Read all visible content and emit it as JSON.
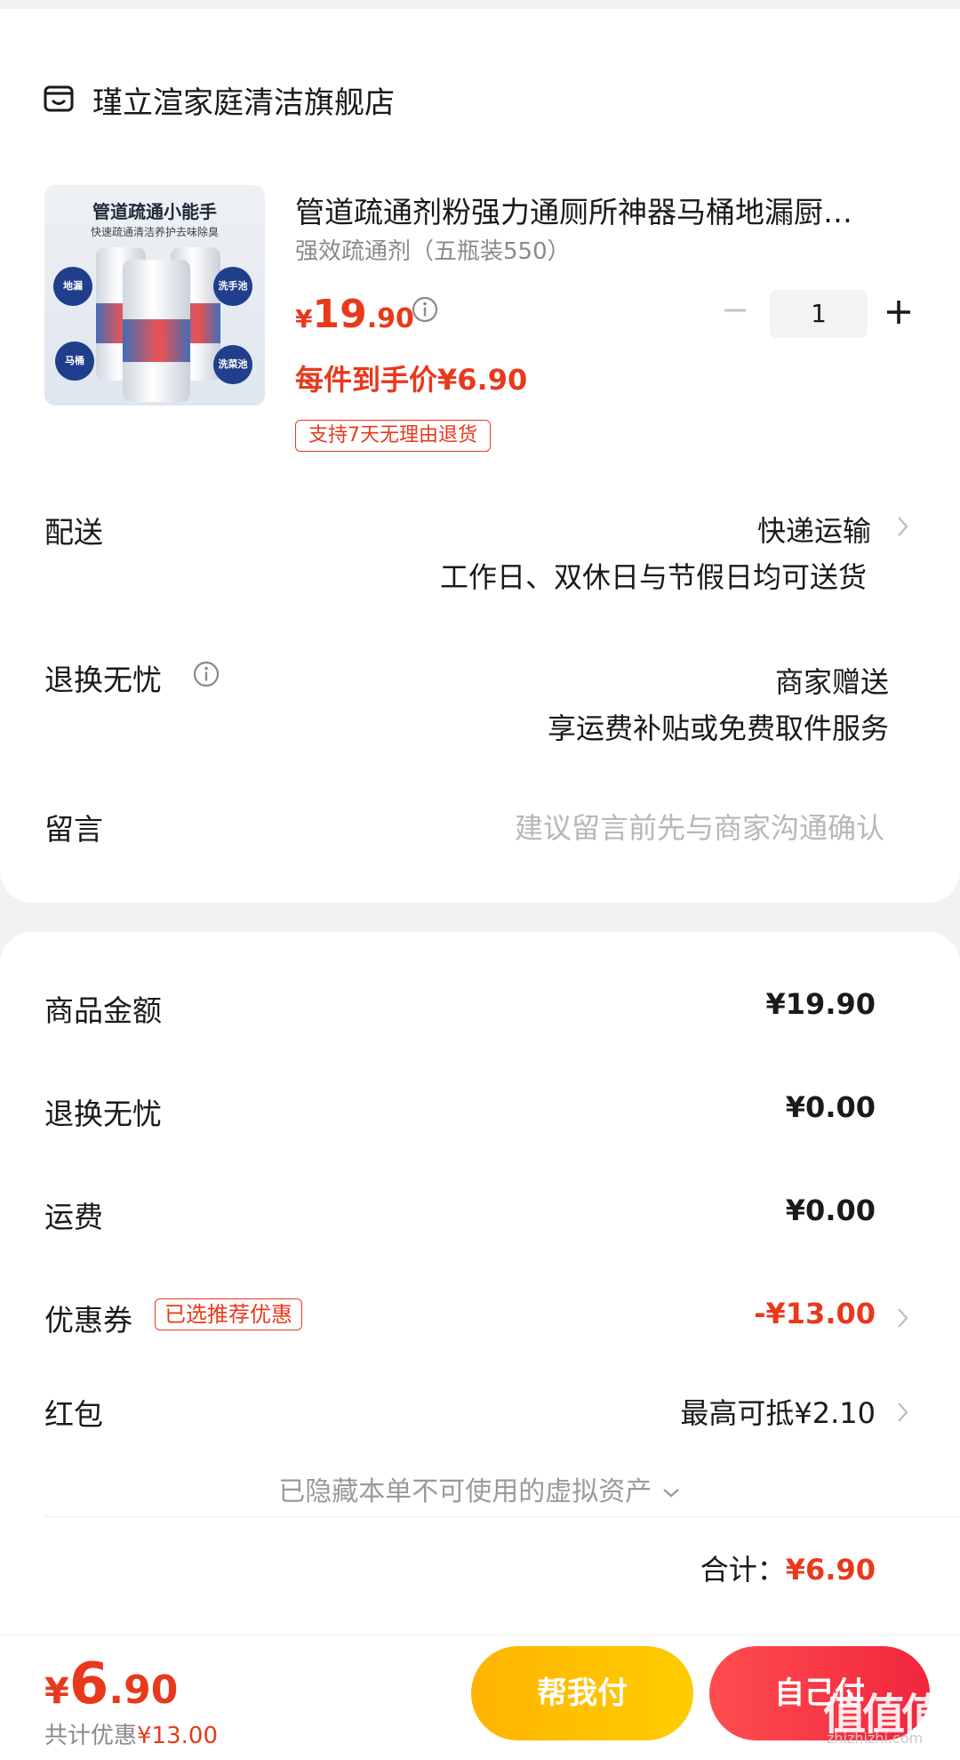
{
  "store": {
    "name": "瑾立渲家庭清洁旗舰店",
    "icon": "store-icon"
  },
  "product": {
    "image_title": "管道疏通小能手",
    "image_subtitle": "快速疏通清洁养护去味除臭",
    "image_labels": [
      "地漏",
      "洗手池",
      "马桶",
      "洗菜池"
    ],
    "title": "管道疏通剂粉强力通厕所神器马桶地漏厨…",
    "variant": "强效疏通剂（五瓶装550）",
    "price_currency": "¥",
    "price_int": "19",
    "price_dec": ".90",
    "per_item_price": "每件到手价¥6.90",
    "return_tag": "支持7天无理由退货",
    "quantity": "1"
  },
  "delivery": {
    "label": "配送",
    "method": "快递运输",
    "detail": "工作日、双休日与节假日均可送货"
  },
  "return_service": {
    "label": "退换无忧",
    "value": "商家赠送",
    "detail": "享运费补贴或免费取件服务"
  },
  "message": {
    "label": "留言",
    "placeholder": "建议留言前先与商家沟通确认"
  },
  "summary": {
    "goods_label": "商品金额",
    "goods_value": "¥19.90",
    "return_label": "退换无忧",
    "return_value": "¥0.00",
    "shipping_label": "运费",
    "shipping_value": "¥0.00",
    "coupon_label": "优惠券",
    "coupon_badge": "已选推荐优惠",
    "coupon_value": "-¥13.00",
    "redpacket_label": "红包",
    "redpacket_value": "最高可抵¥2.10",
    "hidden_assets": "已隐藏本单不可使用的虚拟资产",
    "total_label": "合计：",
    "total_value": "¥6.90"
  },
  "footer": {
    "price_currency": "¥",
    "price_int": "6",
    "price_dec": ".90",
    "saved_label": "共计优惠",
    "saved_value": "¥13.00",
    "help_pay": "帮我付",
    "self_pay": "自己付"
  },
  "watermark": {
    "mark": "值值值",
    "site": "zhizhizhi.com"
  },
  "colors": {
    "accent": "#e8391d",
    "help_btn": "#ffbf00",
    "pay_btn": "#f0263d"
  }
}
